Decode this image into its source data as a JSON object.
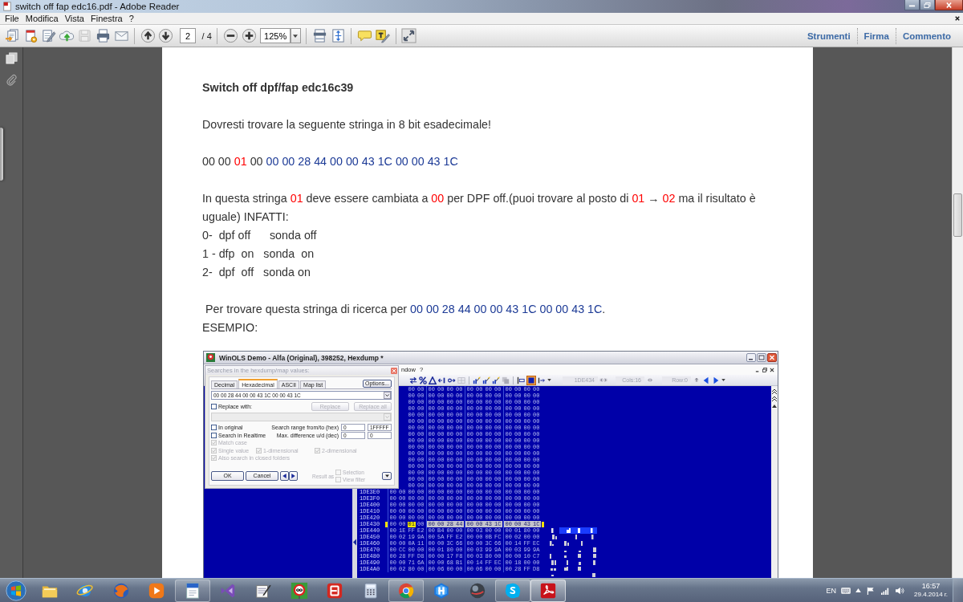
{
  "window": {
    "title": "switch off fap edc16.pdf - Adobe Reader"
  },
  "menu": [
    "File",
    "Modifica",
    "Vista",
    "Finestra",
    "?"
  ],
  "toolbar": {
    "page": "2",
    "page_count": "/ 4",
    "zoom": "125%"
  },
  "panes": [
    {
      "label": "Strumenti"
    },
    {
      "label": "Firma"
    },
    {
      "label": "Commento"
    }
  ],
  "document": {
    "heading": "Switch off dpf/fap edc16c39",
    "blocks": [
      {
        "lines": [
          [
            {
              "text": "Dovresti trovare la seguente stringa in 8 bit esadecimale!",
              "kind": "plain"
            }
          ]
        ]
      },
      {
        "lines": [
          [
            {
              "text": "00 00 ",
              "kind": "plain"
            },
            {
              "text": "01",
              "kind": "flag"
            },
            {
              "text": " 00 ",
              "kind": "plain"
            },
            {
              "text": "00 00 28 44 00 00 43 1C 00 00 43 1C",
              "kind": "pattern"
            }
          ]
        ]
      },
      {
        "lines": [
          [
            {
              "text": "In questa stringa ",
              "kind": "plain"
            },
            {
              "text": "01",
              "kind": "flag"
            },
            {
              "text": " deve essere cambiata a ",
              "kind": "plain"
            },
            {
              "text": "00",
              "kind": "flag"
            },
            {
              "text": " per DPF off.(puoi trovare al posto di ",
              "kind": "plain"
            },
            {
              "text": "01",
              "kind": "flag"
            },
            {
              "text": " → ",
              "kind": "plain"
            },
            {
              "text": "02",
              "kind": "flag"
            },
            {
              "text": " ma il risultato è uguale) INFATTI:",
              "kind": "plain"
            }
          ],
          [
            {
              "text": "0-  dpf off      sonda off",
              "kind": "plain"
            }
          ],
          [
            {
              "text": "1 - dfp  on   sonda  on",
              "kind": "plain"
            }
          ],
          [
            {
              "text": "2-  dpf  off   sonda on",
              "kind": "plain"
            }
          ]
        ]
      },
      {
        "lines": [
          [
            {
              "text": " Per trovare questa stringa di ricerca per ",
              "kind": "plain"
            },
            {
              "text": "00 00 28 44 00 00 43 1C 00 00 43 1C",
              "kind": "pattern"
            },
            {
              "text": ".",
              "kind": "plain"
            }
          ],
          [
            {
              "text": "ESEMPIO:",
              "kind": "plain"
            }
          ]
        ]
      }
    ]
  },
  "screenshot": {
    "title": "WinOLS Demo - Alfa (Original), 398252, Hexdump *",
    "menu": [
      "ndow",
      "?"
    ],
    "toolbar": {
      "address": "1DE434",
      "columns": "Cols:16",
      "row": "Row:0"
    },
    "hexdump": {
      "rows": [
        {
          "selected": false,
          "segments": [
            {
              "kind": "plain",
              "bytes": [
                "00",
                "00",
                "00",
                "00",
                "00",
                "00",
                "00",
                "00",
                "00",
                "00",
                "00",
                "00",
                "00",
                "00"
              ]
            }
          ]
        },
        {
          "selected": false,
          "segments": [
            {
              "kind": "plain",
              "bytes": [
                "00",
                "00",
                "00",
                "00",
                "00",
                "00",
                "00",
                "00",
                "00",
                "00",
                "00",
                "00",
                "00",
                "00"
              ]
            }
          ]
        },
        {
          "selected": false,
          "segments": [
            {
              "kind": "plain",
              "bytes": [
                "00",
                "00",
                "00",
                "00",
                "00",
                "00",
                "00",
                "00",
                "00",
                "00",
                "00",
                "00",
                "00",
                "00"
              ]
            }
          ]
        },
        {
          "selected": false,
          "segments": [
            {
              "kind": "plain",
              "bytes": [
                "00",
                "00",
                "00",
                "00",
                "00",
                "00",
                "00",
                "00",
                "00",
                "00",
                "00",
                "00",
                "00",
                "00"
              ]
            }
          ]
        },
        {
          "selected": false,
          "segments": [
            {
              "kind": "plain",
              "bytes": [
                "00",
                "00",
                "00",
                "00",
                "00",
                "00",
                "00",
                "00",
                "00",
                "00",
                "00",
                "00",
                "00",
                "00"
              ]
            }
          ]
        },
        {
          "selected": false,
          "segments": [
            {
              "kind": "plain",
              "bytes": [
                "00",
                "00",
                "00",
                "00",
                "00",
                "00",
                "00",
                "00",
                "00",
                "00",
                "00",
                "00",
                "00",
                "00"
              ]
            }
          ]
        },
        {
          "selected": false,
          "segments": [
            {
              "kind": "plain",
              "bytes": [
                "00",
                "00",
                "00",
                "00",
                "00",
                "00",
                "00",
                "00",
                "00",
                "00",
                "00",
                "00",
                "00",
                "00"
              ]
            }
          ]
        },
        {
          "selected": false,
          "segments": [
            {
              "kind": "plain",
              "bytes": [
                "00",
                "00",
                "00",
                "00",
                "00",
                "00",
                "00",
                "00",
                "00",
                "00",
                "00",
                "00",
                "00",
                "00"
              ]
            }
          ]
        },
        {
          "selected": false,
          "segments": [
            {
              "kind": "plain",
              "bytes": [
                "00",
                "00",
                "00",
                "00",
                "00",
                "00",
                "00",
                "00",
                "00",
                "00",
                "00",
                "00",
                "00",
                "00"
              ]
            }
          ]
        },
        {
          "selected": false,
          "segments": [
            {
              "kind": "plain",
              "bytes": [
                "00",
                "00",
                "00",
                "00",
                "00",
                "00",
                "00",
                "00",
                "00",
                "00",
                "00",
                "00",
                "00",
                "00"
              ]
            }
          ]
        },
        {
          "selected": false,
          "segments": [
            {
              "kind": "plain",
              "bytes": [
                "00",
                "00",
                "00",
                "00",
                "00",
                "00",
                "00",
                "00",
                "00",
                "00",
                "00",
                "00",
                "00",
                "00"
              ]
            }
          ]
        },
        {
          "selected": false,
          "segments": [
            {
              "kind": "plain",
              "bytes": [
                "00",
                "00",
                "00",
                "00",
                "00",
                "00",
                "00",
                "00",
                "00",
                "00",
                "00",
                "00",
                "00",
                "00"
              ]
            }
          ]
        },
        {
          "selected": false,
          "segments": [
            {
              "kind": "plain",
              "bytes": [
                "00",
                "00",
                "00",
                "00",
                "00",
                "00",
                "00",
                "00",
                "00",
                "00",
                "00",
                "00",
                "00",
                "00"
              ]
            }
          ]
        },
        {
          "selected": false,
          "segments": [
            {
              "kind": "plain",
              "bytes": [
                "00",
                "00",
                "00",
                "00",
                "00",
                "00",
                "00",
                "00",
                "00",
                "00",
                "00",
                "00",
                "00",
                "00"
              ]
            }
          ]
        },
        {
          "selected": false,
          "segments": [
            {
              "kind": "plain",
              "bytes": [
                "00",
                "00",
                "00",
                "00",
                "00",
                "00",
                "00",
                "00",
                "00",
                "00",
                "00",
                "00",
                "00",
                "00"
              ]
            }
          ]
        },
        {
          "selected": false,
          "segments": [
            {
              "kind": "plain",
              "bytes": [
                "00",
                "00",
                "00",
                "00",
                "00",
                "00",
                "00",
                "00",
                "00",
                "00",
                "00",
                "00",
                "00",
                "00"
              ]
            }
          ]
        },
        {
          "address": "1DE3E0",
          "selected": false,
          "segments": [
            {
              "kind": "plain",
              "bytes": [
                "00",
                "00",
                "00",
                "00",
                "00",
                "00",
                "00",
                "00",
                "00",
                "00",
                "00",
                "00",
                "00",
                "00",
                "00",
                "00"
              ]
            }
          ]
        },
        {
          "address": "1DE3F0",
          "selected": false,
          "segments": [
            {
              "kind": "plain",
              "bytes": [
                "00",
                "00",
                "00",
                "00",
                "00",
                "00",
                "00",
                "00",
                "00",
                "00",
                "00",
                "00",
                "00",
                "00",
                "00",
                "00"
              ]
            }
          ]
        },
        {
          "address": "1DE400",
          "selected": false,
          "segments": [
            {
              "kind": "plain",
              "bytes": [
                "00",
                "00",
                "00",
                "00",
                "00",
                "00",
                "00",
                "00",
                "00",
                "00",
                "00",
                "00",
                "00",
                "00",
                "00",
                "00"
              ]
            }
          ]
        },
        {
          "address": "1DE410",
          "selected": false,
          "segments": [
            {
              "kind": "plain",
              "bytes": [
                "00",
                "00",
                "00",
                "00",
                "00",
                "00",
                "00",
                "00",
                "00",
                "00",
                "00",
                "00",
                "00",
                "00",
                "00",
                "00"
              ]
            }
          ]
        },
        {
          "address": "1DE420",
          "selected": false,
          "segments": [
            {
              "kind": "plain",
              "bytes": [
                "00",
                "00",
                "00",
                "00",
                "00",
                "00",
                "00",
                "00",
                "00",
                "00",
                "00",
                "00",
                "00",
                "00",
                "00",
                "00"
              ]
            }
          ]
        },
        {
          "address": "1DE430",
          "selected": true,
          "segments": [
            {
              "kind": "plain",
              "bytes": [
                "00",
                "00"
              ]
            },
            {
              "kind": "cursor",
              "bytes": [
                "01"
              ]
            },
            {
              "kind": "plain",
              "bytes": [
                "00"
              ]
            },
            {
              "kind": "match",
              "bytes": [
                "00",
                "00",
                "28",
                "44",
                "00",
                "00",
                "43",
                "1C",
                "00",
                "00",
                "43",
                "1C"
              ]
            }
          ]
        },
        {
          "address": "1DE440",
          "selected": false,
          "segments": [
            {
              "kind": "plain",
              "bytes": [
                "00",
                "1E",
                "FF",
                "E2",
                "00",
                "B4",
                "00",
                "00",
                "00",
                "03",
                "00",
                "00",
                "00",
                "01",
                "80",
                "00"
              ]
            }
          ]
        },
        {
          "address": "1DE450",
          "selected": false,
          "segments": [
            {
              "kind": "plain",
              "bytes": [
                "00",
                "02",
                "19",
                "9A",
                "00",
                "5A",
                "FF",
                "E2",
                "00",
                "00",
                "0B",
                "FC",
                "00",
                "02",
                "00",
                "00"
              ]
            }
          ]
        },
        {
          "address": "1DE460",
          "selected": false,
          "segments": [
            {
              "kind": "plain",
              "bytes": [
                "00",
                "00",
                "0A",
                "11",
                "00",
                "00",
                "3C",
                "66",
                "00",
                "00",
                "3C",
                "66",
                "00",
                "14",
                "FF",
                "EC"
              ]
            }
          ]
        },
        {
          "address": "1DE470",
          "selected": false,
          "segments": [
            {
              "kind": "plain",
              "bytes": [
                "00",
                "CC",
                "00",
                "00",
                "00",
                "01",
                "80",
                "00",
                "00",
                "03",
                "99",
                "9A",
                "00",
                "03",
                "99",
                "9A"
              ]
            }
          ]
        },
        {
          "address": "1DE480",
          "selected": false,
          "segments": [
            {
              "kind": "plain",
              "bytes": [
                "00",
                "28",
                "FF",
                "D8",
                "00",
                "00",
                "17",
                "F8",
                "00",
                "03",
                "80",
                "00",
                "00",
                "00",
                "10",
                "C7"
              ]
            }
          ]
        },
        {
          "address": "1DE490",
          "selected": false,
          "segments": [
            {
              "kind": "plain",
              "bytes": [
                "00",
                "00",
                "71",
                "6A",
                "00",
                "00",
                "68",
                "B1",
                "00",
                "14",
                "FF",
                "EC",
                "00",
                "18",
                "00",
                "00"
              ]
            }
          ]
        },
        {
          "address": "1DE4A0",
          "selected": false,
          "segments": [
            {
              "kind": "plain",
              "bytes": [
                "00",
                "02",
                "80",
                "00",
                "00",
                "06",
                "00",
                "00",
                "00",
                "06",
                "00",
                "00",
                "00",
                "28",
                "FF",
                "D8"
              ]
            }
          ]
        }
      ]
    },
    "dialog": {
      "title": "Searches in the hexdump/map values:",
      "tabs": [
        {
          "label": "Decimal",
          "selected": false
        },
        {
          "label": "Hexadecimal",
          "selected": true
        },
        {
          "label": "ASCII",
          "selected": false
        },
        {
          "label": "Map list",
          "selected": false
        }
      ],
      "options": "Options...",
      "search": {
        "value": "00 00 28 44 00 00 43 1C 00 00 43 1C"
      },
      "replace": {
        "label": "Replace with:",
        "checked": false
      },
      "replace_buttons": [
        {
          "label": "Replace",
          "disabled": true
        },
        {
          "label": "Replace all",
          "disabled": true
        }
      ],
      "ranges": [
        {
          "label": "Search range from/to (hex)",
          "from": "0",
          "to": "1FFFFF"
        },
        {
          "label": "Max. difference u/d (dec)",
          "from": "0",
          "to": "0"
        }
      ],
      "checkbox_rows": [
        [
          {
            "label": "In original",
            "checked": false,
            "disabled": false
          }
        ],
        [
          {
            "label": "Search in Realtime",
            "checked": false,
            "disabled": false
          }
        ],
        [
          {
            "label": "Match case",
            "checked": true,
            "disabled": true
          }
        ],
        [
          {
            "label": "Single value",
            "checked": true,
            "disabled": true
          },
          {
            "label": "1-dimensional",
            "checked": true,
            "disabled": true
          },
          {
            "label": "2-dimensional",
            "checked": true,
            "disabled": true
          }
        ],
        [
          {
            "label": "Also search in closed folders",
            "checked": true,
            "disabled": true
          }
        ]
      ],
      "buttons": [
        {
          "label": "OK"
        },
        {
          "label": "Cancel"
        }
      ],
      "result": {
        "label": "Result as",
        "disabled": true,
        "options": [
          {
            "label": "Selection",
            "checked": false
          },
          {
            "label": "View filter",
            "checked": false
          }
        ]
      }
    }
  },
  "taskbar": {
    "apps": [
      {
        "kind": "folder",
        "running": false,
        "selected": false
      },
      {
        "kind": "orbit",
        "running": false,
        "selected": false
      },
      {
        "kind": "globe",
        "running": false,
        "selected": false
      },
      {
        "kind": "play",
        "running": false,
        "selected": false
      },
      {
        "kind": "page",
        "running": true,
        "selected": false
      },
      {
        "kind": "ribbon",
        "running": false,
        "selected": false
      },
      {
        "kind": "notepad",
        "running": false,
        "selected": false
      },
      {
        "kind": "sign",
        "running": false,
        "selected": false
      },
      {
        "kind": "tile",
        "running": false,
        "selected": false
      },
      {
        "kind": "calculator",
        "running": false,
        "selected": false
      },
      {
        "kind": "wheel",
        "running": true,
        "selected": false
      },
      {
        "kind": "hexagon",
        "running": false,
        "selected": false
      },
      {
        "kind": "sphere",
        "running": false,
        "selected": false
      },
      {
        "kind": "bubble",
        "running": true,
        "selected": false
      },
      {
        "kind": "swirl",
        "running": true,
        "selected": true
      }
    ],
    "tray": {
      "language": "EN",
      "time": "16:57",
      "date": "29.4.2014 г."
    }
  }
}
